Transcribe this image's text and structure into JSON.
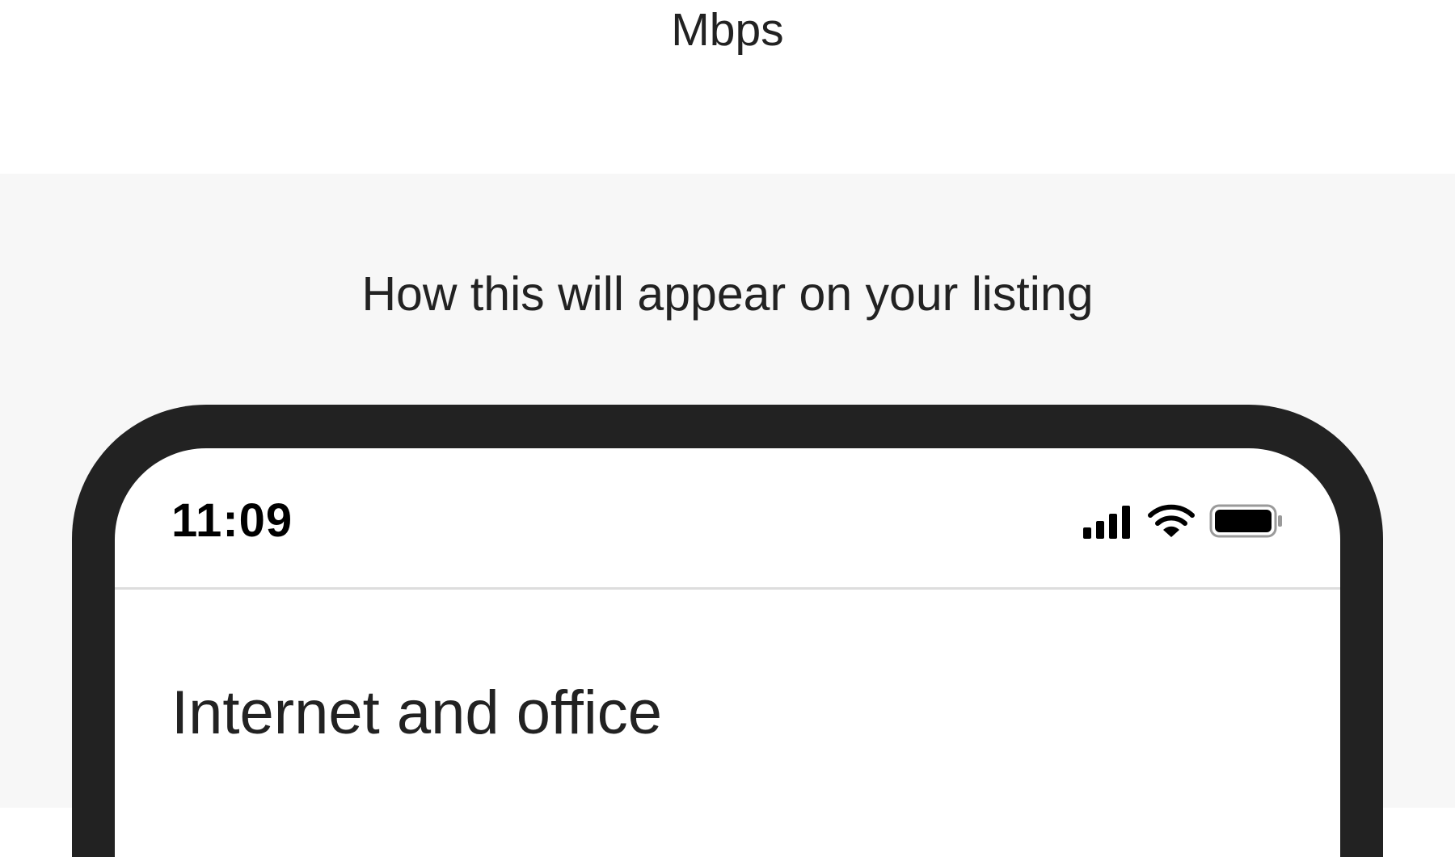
{
  "form": {
    "unit_label": "Mbps"
  },
  "preview": {
    "heading": "How this will appear on your listing",
    "phone": {
      "status_bar": {
        "time": "11:09",
        "icons": [
          "cellular-signal-icon",
          "wifi-icon",
          "battery-icon"
        ]
      },
      "screen_title": "Internet and office"
    }
  },
  "colors": {
    "text": "#222222",
    "phone_frame": "#222222",
    "preview_background": "#f7f7f7",
    "divider": "#dddddd"
  }
}
